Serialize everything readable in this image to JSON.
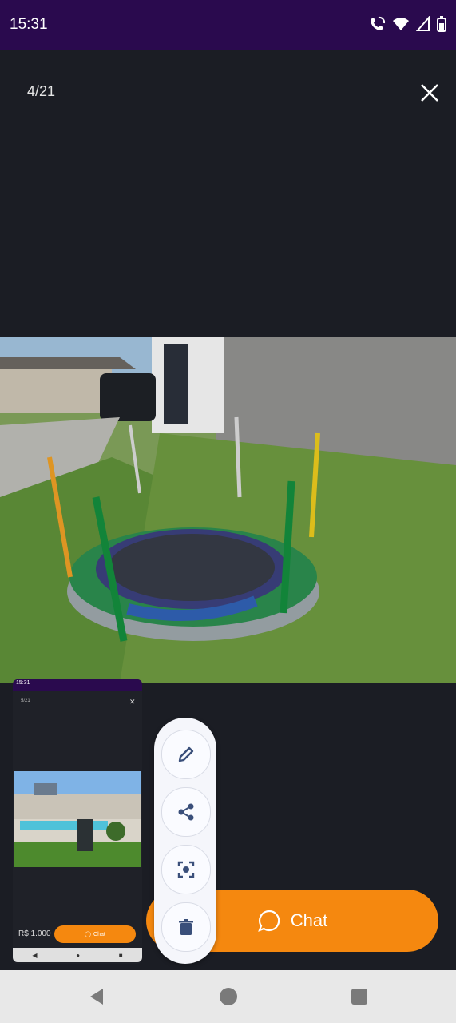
{
  "status_bar": {
    "time": "15:31"
  },
  "viewer": {
    "counter": "4/21"
  },
  "thumbnail": {
    "counter": "5/21",
    "price": "R$ 1.000",
    "chat_label": "Chat"
  },
  "chat_button": {
    "label": "Chat"
  },
  "colors": {
    "accent": "#f5880f",
    "status_bar": "#2a0a4e",
    "background": "#1b1d24"
  },
  "fab_menu": {
    "items": [
      {
        "icon": "pencil-icon",
        "action": "edit"
      },
      {
        "icon": "share-icon",
        "action": "share"
      },
      {
        "icon": "screenshot-capture-icon",
        "action": "capture"
      },
      {
        "icon": "trash-icon",
        "action": "delete"
      }
    ]
  }
}
